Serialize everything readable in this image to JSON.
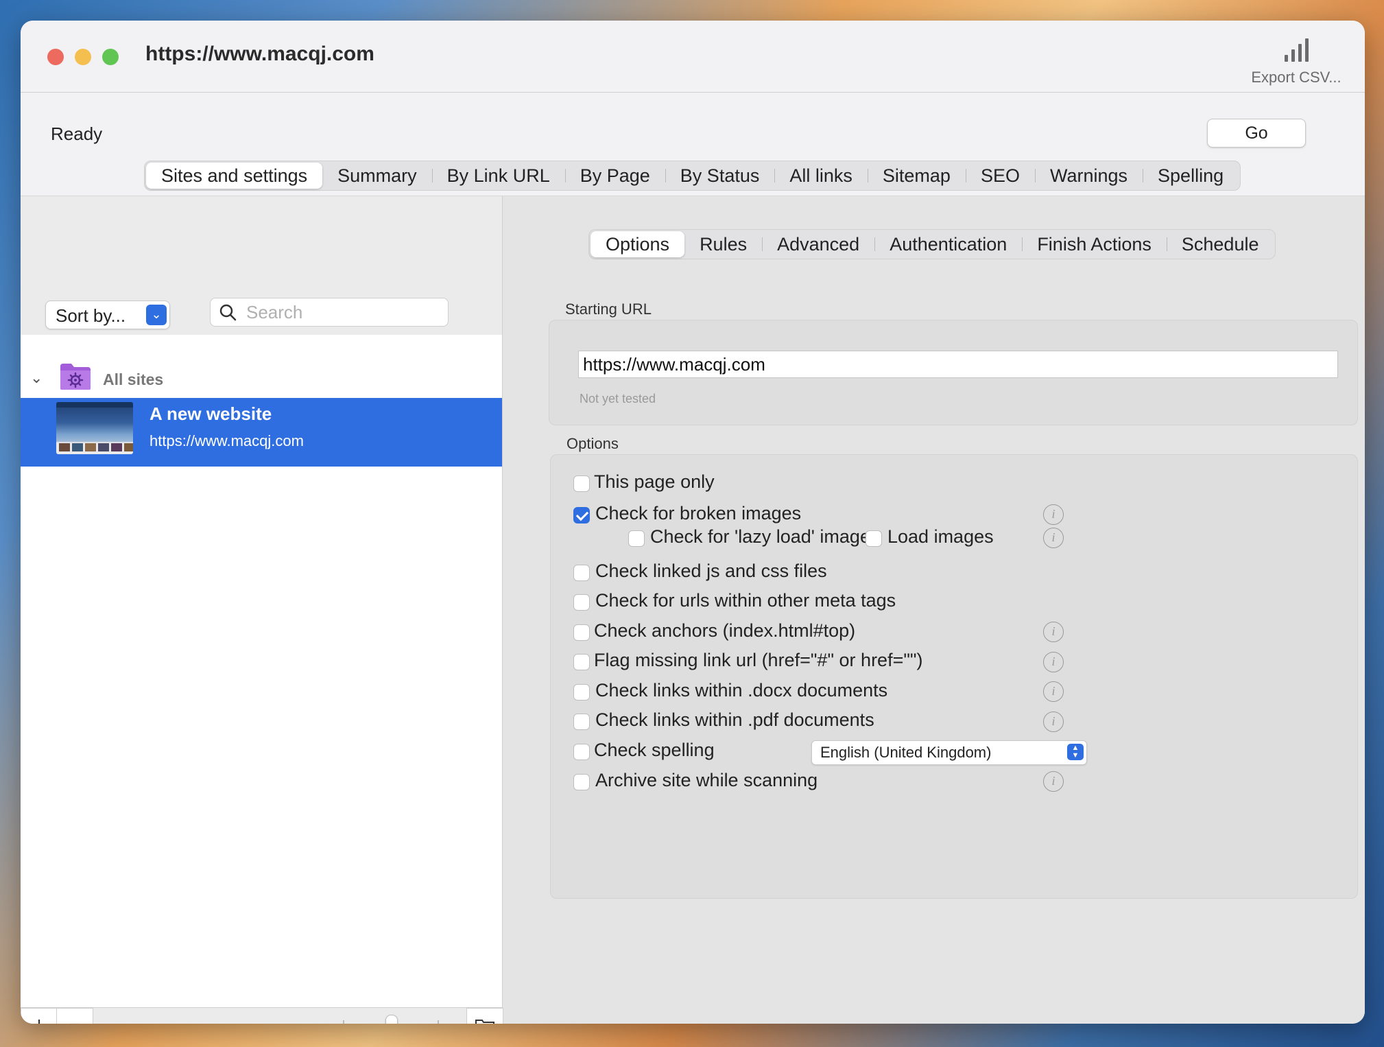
{
  "window": {
    "title": "https://www.macqj.com",
    "export_label": "Export CSV..."
  },
  "status_text": "Ready",
  "go_label": "Go",
  "main_tabs": [
    "Sites and settings",
    "Summary",
    "By Link URL",
    "By Page",
    "By Status",
    "All links",
    "Sitemap",
    "SEO",
    "Warnings",
    "Spelling"
  ],
  "main_tabs_active": 0,
  "sidebar": {
    "sort_label": "Sort by...",
    "search_placeholder": "Search",
    "group_label": "All sites",
    "site": {
      "name": "A new website",
      "url": "https://www.macqj.com"
    },
    "add_label": "+",
    "remove_label": "−"
  },
  "sub_tabs": [
    "Options",
    "Rules",
    "Advanced",
    "Authentication",
    "Finish Actions",
    "Schedule"
  ],
  "sub_tabs_active": 0,
  "starting_url": {
    "label": "Starting URL",
    "value": "https://www.macqj.com",
    "hint": "Not yet tested"
  },
  "options": {
    "label": "Options",
    "items": [
      {
        "label": "This page only",
        "checked": false,
        "info": false
      },
      {
        "label": "Check for broken images",
        "checked": true,
        "info": true
      },
      {
        "label": "Check for 'lazy load' images",
        "checked": false,
        "info": true
      },
      {
        "label": "Load images",
        "checked": false,
        "info": false
      },
      {
        "label": "Check linked js and css files",
        "checked": false,
        "info": false
      },
      {
        "label": "Check for urls within other meta tags",
        "checked": false,
        "info": false
      },
      {
        "label": "Check anchors (index.html#top)",
        "checked": false,
        "info": true
      },
      {
        "label": "Flag missing link url (href=\"#\" or href=\"\")",
        "checked": false,
        "info": true
      },
      {
        "label": "Check links within .docx documents",
        "checked": false,
        "info": true
      },
      {
        "label": "Check links within .pdf documents",
        "checked": false,
        "info": true
      },
      {
        "label": "Check spelling",
        "checked": false,
        "info": false
      },
      {
        "label": "Archive site while scanning",
        "checked": false,
        "info": true
      }
    ],
    "spelling_language": "English (United Kingdom)"
  },
  "icons": {
    "export": "bar-chart-icon",
    "search": "magnifier-icon",
    "folder": "gear-folder-icon",
    "browse": "folder-icon",
    "info": "info-icon"
  },
  "colors": {
    "accent": "#2f6ee0",
    "folder": "#a35ddb"
  }
}
